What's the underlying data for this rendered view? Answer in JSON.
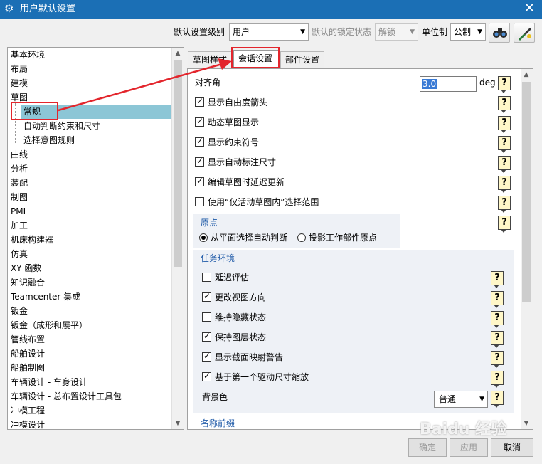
{
  "window": {
    "title": "用户默认设置",
    "close_symbol": "✕"
  },
  "toolbar": {
    "level_label": "默认设置级别",
    "level_value": "用户",
    "lock_label": "默认的锁定状态",
    "lock_value": "解锁",
    "unit_label": "单位制",
    "unit_value": "公制"
  },
  "tree": {
    "items": [
      {
        "label": "基本环境"
      },
      {
        "label": "布局"
      },
      {
        "label": "建模"
      },
      {
        "label": "草图"
      },
      {
        "label": "常规"
      },
      {
        "label": "自动判断约束和尺寸"
      },
      {
        "label": "选择意图规则"
      },
      {
        "label": "曲线"
      },
      {
        "label": "分析"
      },
      {
        "label": "装配"
      },
      {
        "label": "制图"
      },
      {
        "label": "PMI"
      },
      {
        "label": "加工"
      },
      {
        "label": "机床构建器"
      },
      {
        "label": "仿真"
      },
      {
        "label": "XY 函数"
      },
      {
        "label": "知识融合"
      },
      {
        "label": "Teamcenter 集成"
      },
      {
        "label": "钣金"
      },
      {
        "label": "钣金（成形和展平）"
      },
      {
        "label": "管线布置"
      },
      {
        "label": "船舶设计"
      },
      {
        "label": "船舶制图"
      },
      {
        "label": "车辆设计 - 车身设计"
      },
      {
        "label": "车辆设计 - 总布置设计工具包"
      },
      {
        "label": "冲模工程"
      },
      {
        "label": "冲模设计"
      }
    ]
  },
  "tabs": [
    {
      "label": "草图样式"
    },
    {
      "label": "会话设置"
    },
    {
      "label": "部件设置"
    }
  ],
  "session": {
    "snap_angle_label": "对齐角",
    "snap_angle_value": "3.0",
    "snap_angle_unit": "deg",
    "options": [
      {
        "label": "显示自由度箭头",
        "checked": true
      },
      {
        "label": "动态草图显示",
        "checked": true
      },
      {
        "label": "显示约束符号",
        "checked": true
      },
      {
        "label": "显示自动标注尺寸",
        "checked": true
      },
      {
        "label": "编辑草图时延迟更新",
        "checked": true
      },
      {
        "label": "使用“仅活动草图内”选择范围",
        "checked": false
      }
    ],
    "origin": {
      "title": "原点",
      "option1": "从平面选择自动判断",
      "option2": "投影工作部件原点"
    },
    "task_env": {
      "title": "任务环境",
      "options": [
        {
          "label": "延迟评估",
          "checked": false
        },
        {
          "label": "更改视图方向",
          "checked": true
        },
        {
          "label": "维持隐藏状态",
          "checked": false
        },
        {
          "label": "保持图层状态",
          "checked": true
        },
        {
          "label": "显示截面映射警告",
          "checked": true
        },
        {
          "label": "基于第一个驱动尺寸缩放",
          "checked": true
        }
      ],
      "bg_label": "背景色",
      "bg_value": "普通"
    },
    "next_group_title": "名称前缀",
    "help_symbol": "?"
  },
  "footer": {
    "ok": "确定",
    "apply": "应用",
    "cancel": "取消"
  },
  "watermark": "Baidu 经验"
}
